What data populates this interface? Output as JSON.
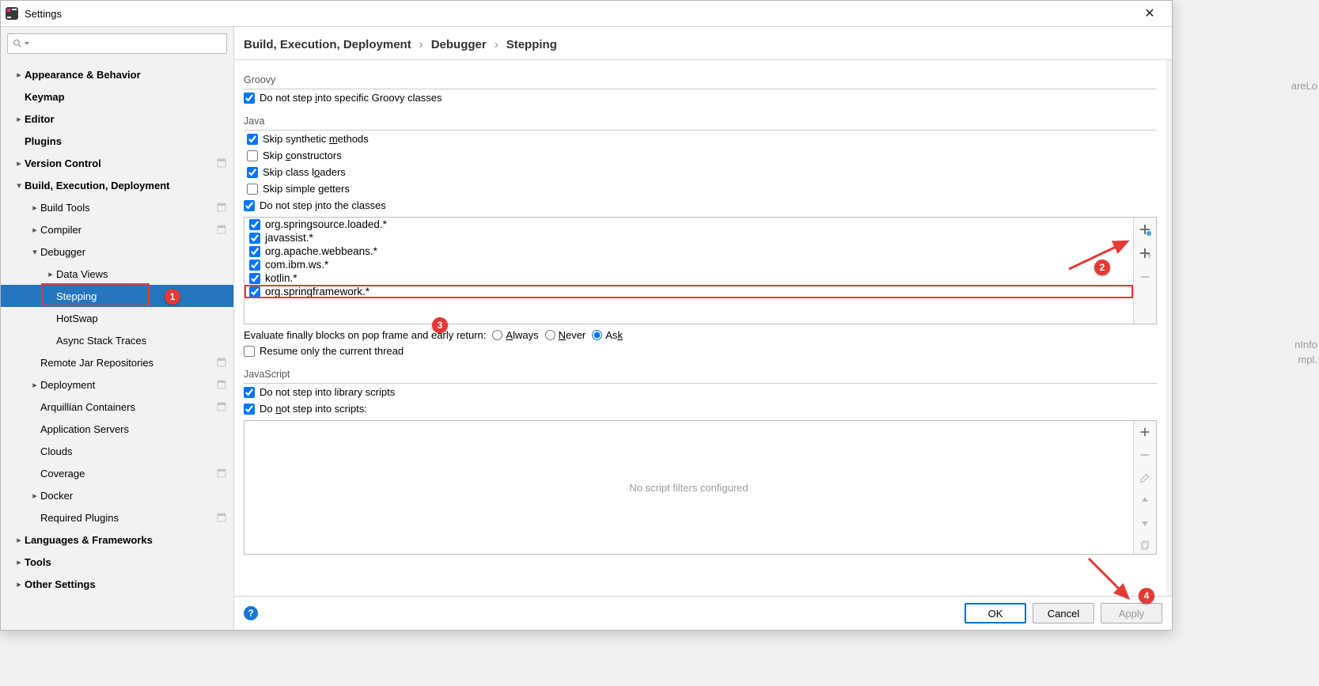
{
  "window": {
    "title": "Settings"
  },
  "bg_text": [
    "areLo",
    "",
    "",
    "",
    "",
    "",
    "",
    "",
    "",
    "",
    "",
    "",
    "",
    "",
    "",
    "",
    "",
    "",
    "nInfo",
    "mpl."
  ],
  "search": {
    "placeholder": ""
  },
  "breadcrumbs": [
    "Build, Execution, Deployment",
    "Debugger",
    "Stepping"
  ],
  "sidebar": [
    {
      "label": "Appearance & Behavior",
      "depth": 0,
      "bold": true,
      "arrow": ">"
    },
    {
      "label": "Keymap",
      "depth": 0,
      "bold": true
    },
    {
      "label": "Editor",
      "depth": 0,
      "bold": true,
      "arrow": ">"
    },
    {
      "label": "Plugins",
      "depth": 0,
      "bold": true
    },
    {
      "label": "Version Control",
      "depth": 0,
      "bold": true,
      "arrow": ">",
      "proj": true
    },
    {
      "label": "Build, Execution, Deployment",
      "depth": 0,
      "bold": true,
      "arrow": "v"
    },
    {
      "label": "Build Tools",
      "depth": 1,
      "arrow": ">",
      "proj": true
    },
    {
      "label": "Compiler",
      "depth": 1,
      "arrow": ">",
      "proj": true
    },
    {
      "label": "Debugger",
      "depth": 1,
      "arrow": "v"
    },
    {
      "label": "Data Views",
      "depth": 2,
      "arrow": ">"
    },
    {
      "label": "Stepping",
      "depth": 2,
      "selected": true,
      "annot": 1
    },
    {
      "label": "HotSwap",
      "depth": 2
    },
    {
      "label": "Async Stack Traces",
      "depth": 2
    },
    {
      "label": "Remote Jar Repositories",
      "depth": 1,
      "proj": true
    },
    {
      "label": "Deployment",
      "depth": 1,
      "arrow": ">",
      "proj": true
    },
    {
      "label": "Arquillian Containers",
      "depth": 1,
      "proj": true
    },
    {
      "label": "Application Servers",
      "depth": 1
    },
    {
      "label": "Clouds",
      "depth": 1
    },
    {
      "label": "Coverage",
      "depth": 1,
      "proj": true
    },
    {
      "label": "Docker",
      "depth": 1,
      "arrow": ">"
    },
    {
      "label": "Required Plugins",
      "depth": 1,
      "proj": true
    },
    {
      "label": "Languages & Frameworks",
      "depth": 0,
      "bold": true,
      "arrow": ">"
    },
    {
      "label": "Tools",
      "depth": 0,
      "bold": true,
      "arrow": ">"
    },
    {
      "label": "Other Settings",
      "depth": 0,
      "bold": true,
      "arrow": ">"
    }
  ],
  "groovy": {
    "title": "Groovy",
    "skip_classes_label": "Do not step into specific Groovy classes",
    "skip_classes_checked": true
  },
  "java": {
    "title": "Java",
    "checks": [
      {
        "label": "Skip synthetic methods",
        "checked": true,
        "u": "m"
      },
      {
        "label": "Skip constructors",
        "checked": false,
        "u": "c"
      },
      {
        "label": "Skip class loaders",
        "checked": true,
        "u": "o"
      },
      {
        "label": "Skip simple getters",
        "checked": false,
        "u": "g"
      }
    ],
    "dontstep_label": "Do not step into the classes",
    "dontstep_checked": true,
    "classes": [
      {
        "name": "org.springsource.loaded.*",
        "checked": true
      },
      {
        "name": "javassist.*",
        "checked": true
      },
      {
        "name": "org.apache.webbeans.*",
        "checked": true
      },
      {
        "name": "com.ibm.ws.*",
        "checked": true
      },
      {
        "name": "kotlin.*",
        "checked": true
      },
      {
        "name": "org.springframework.*",
        "checked": true,
        "highlight": true
      }
    ],
    "eval_label": "Evaluate finally blocks on pop frame and early return:",
    "eval_options": [
      "Always",
      "Never",
      "Ask"
    ],
    "eval_selected": "Ask",
    "resume_label": "Resume only the current thread",
    "resume_checked": false
  },
  "js": {
    "title": "JavaScript",
    "lib_label": "Do not step into library scripts",
    "lib_checked": true,
    "scripts_label": "Do not step into scripts:",
    "scripts_checked": true,
    "empty_text": "No script filters configured"
  },
  "buttons": {
    "ok": "OK",
    "cancel": "Cancel",
    "apply": "Apply"
  },
  "callouts": {
    "1": "1",
    "2": "2",
    "3": "3",
    "4": "4"
  }
}
